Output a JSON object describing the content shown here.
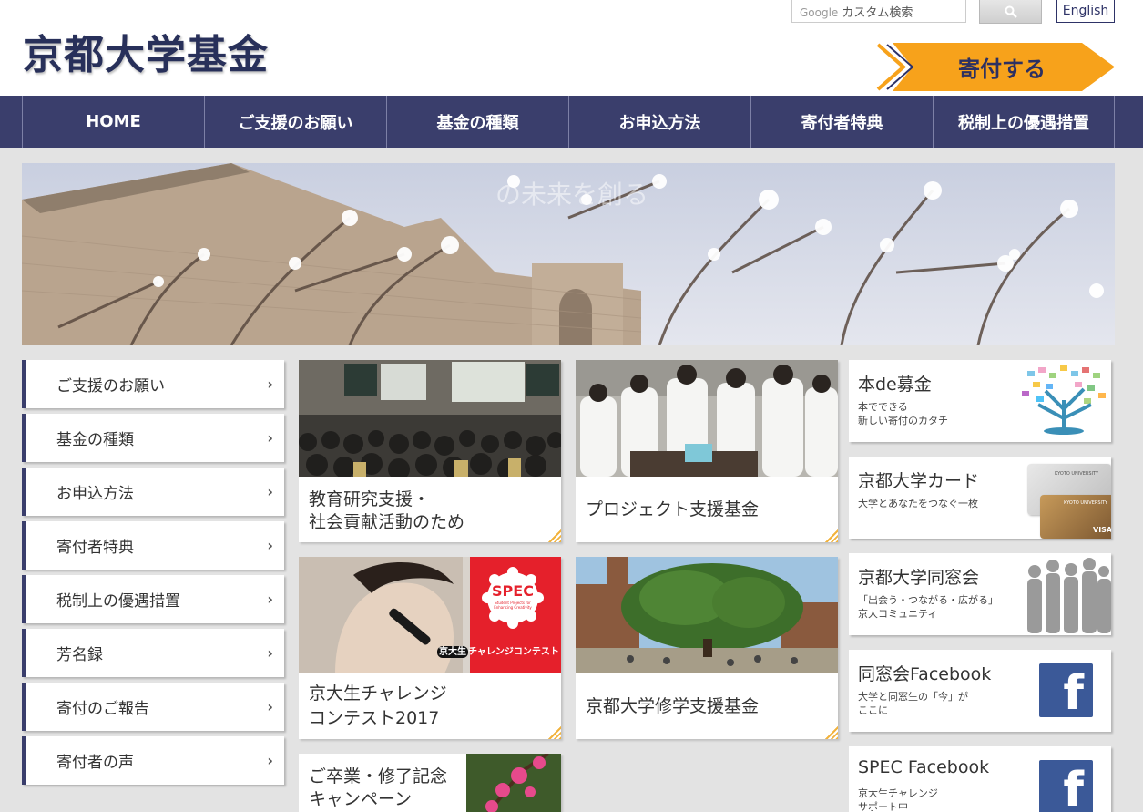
{
  "header": {
    "site_title": "京都大学基金",
    "search_placeholder_brand": "Google",
    "search_placeholder": "カスタム検索",
    "english_label": "English",
    "donate_label": "寄付する"
  },
  "nav": {
    "items": [
      "HOME",
      "ご支援のお願い",
      "基金の種類",
      "お申込方法",
      "寄付者特典",
      "税制上の優遇措置"
    ]
  },
  "hero": {
    "faint_caption": "の未来を創る"
  },
  "side_menu": {
    "items": [
      "ご支援のお願い",
      "基金の種類",
      "お申込方法",
      "寄付者特典",
      "税制上の優遇措置",
      "芳名録",
      "寄付のご報告",
      "寄付者の声"
    ]
  },
  "cards": {
    "education": {
      "line1": "教育研究支援・",
      "line2": "社会貢献活動のため"
    },
    "project": {
      "title": "プロジェクト支援基金"
    },
    "challenge": {
      "line1": "京大生チャレンジ",
      "line2": "コンテスト2017",
      "spec_logo": "SPEC",
      "spec_sub": "Student Projects for Enhancing Creativity",
      "badge_kanji": "京大生",
      "badge_text": "チャレンジコンテスト"
    },
    "study": {
      "title": "京都大学修学支援基金"
    },
    "graduation": {
      "line1": "ご卒業・修了記念",
      "line2": "キャンペーン"
    }
  },
  "right_banners": {
    "book": {
      "title": "本de募金",
      "sub1": "本でできる",
      "sub2": "新しい寄付のカタチ"
    },
    "card": {
      "title": "京都大学カード",
      "sub1": "大学とあなたをつなぐ一枚",
      "card_brand": "KYOTO UNIVERSITY",
      "card_visa": "VISA"
    },
    "alumni": {
      "title": "京都大学同窓会",
      "sub1": "「出会う・つながる・広がる」",
      "sub2": "京大コミュニティ"
    },
    "fb_alumni": {
      "title": "同窓会Facebook",
      "sub1": "大学と同窓生の「今」が",
      "sub2": "ここに"
    },
    "fb_spec": {
      "title": "SPEC Facebook",
      "sub1": "京大生チャレンジ",
      "sub2": "サポート中"
    }
  },
  "colors": {
    "navy": "#3a3e6c",
    "donate_orange": "#f7a21b",
    "spec_red": "#e5202b",
    "facebook_blue": "#3b5998"
  },
  "icons": {
    "search": "magnifier-icon",
    "chevron": "chevron-right-icon",
    "facebook": "facebook-f-icon"
  }
}
